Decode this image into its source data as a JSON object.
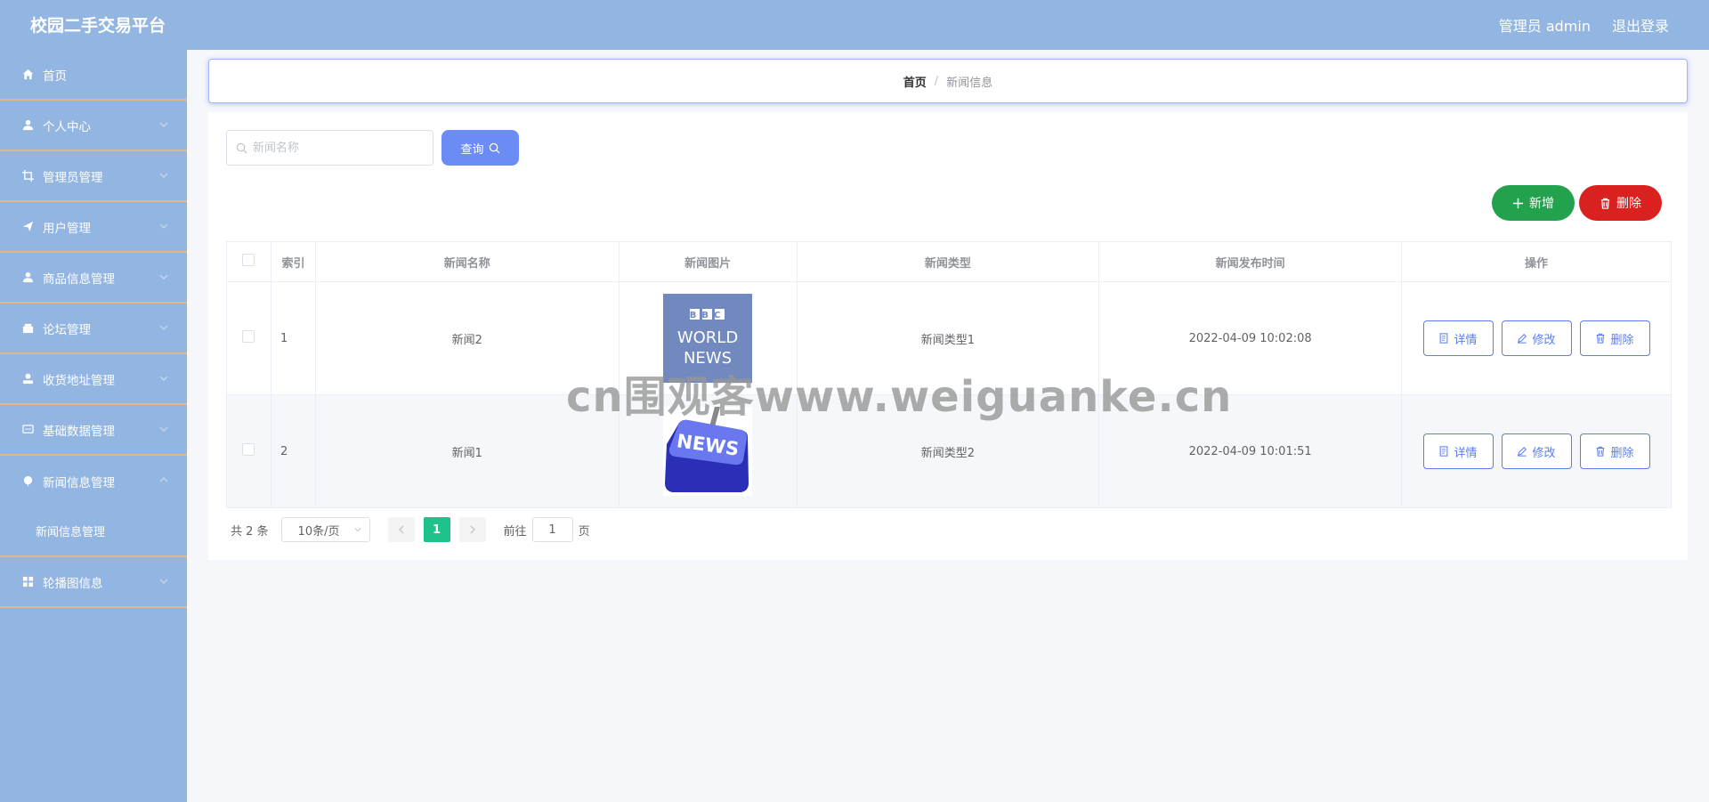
{
  "header": {
    "title": "校园二手交易平台",
    "user_label": "管理员 admin",
    "logout_label": "退出登录"
  },
  "sidebar": {
    "items": [
      {
        "label": "首页",
        "icon": "home-icon"
      },
      {
        "label": "个人中心",
        "icon": "user-icon"
      },
      {
        "label": "管理员管理",
        "icon": "crop-icon"
      },
      {
        "label": "用户管理",
        "icon": "send-icon"
      },
      {
        "label": "商品信息管理",
        "icon": "user-icon"
      },
      {
        "label": "论坛管理",
        "icon": "wallet-icon"
      },
      {
        "label": "收货地址管理",
        "icon": "user-solid-icon"
      },
      {
        "label": "基础数据管理",
        "icon": "chat-icon"
      },
      {
        "label": "新闻信息管理",
        "icon": "pin-icon"
      },
      {
        "label": "轮播图信息",
        "icon": "grid-icon"
      }
    ],
    "sub_item": "新闻信息管理"
  },
  "breadcrumb": {
    "home": "首页",
    "separator": "/",
    "current": "新闻信息"
  },
  "search": {
    "placeholder": "新闻名称",
    "button_label": "查询"
  },
  "actions": {
    "add_label": "新增",
    "delete_label": "删除"
  },
  "table": {
    "headers": [
      "索引",
      "新闻名称",
      "新闻图片",
      "新闻类型",
      "新闻发布时间",
      "操作"
    ],
    "rows": [
      {
        "index": "1",
        "name": "新闻2",
        "image": "bbc-world-news",
        "type": "新闻类型1",
        "time": "2022-04-09 10:02:08"
      },
      {
        "index": "2",
        "name": "新闻1",
        "image": "news-key",
        "type": "新闻类型2",
        "time": "2022-04-09 10:01:51"
      }
    ],
    "op_labels": {
      "detail": "详情",
      "edit": "修改",
      "delete": "删除"
    },
    "image_text": {
      "bbc_logo": "BBC",
      "bbc_line1": "WORLD",
      "bbc_line2": "NEWS",
      "key": "NEWS"
    }
  },
  "pagination": {
    "total": "共 2 条",
    "page_size": "10条/页",
    "current_page": "1",
    "goto_prefix": "前往",
    "goto_value": "1",
    "goto_suffix": "页"
  },
  "watermark": "cn围观客www.weiguanke.cn",
  "colors": {
    "header_bg": "#92b5e1",
    "menu_divider": "#e3b587",
    "primary": "#6c8cf5",
    "success": "#23a24d",
    "danger": "#d9211f",
    "pager_active": "#1ec28b"
  }
}
